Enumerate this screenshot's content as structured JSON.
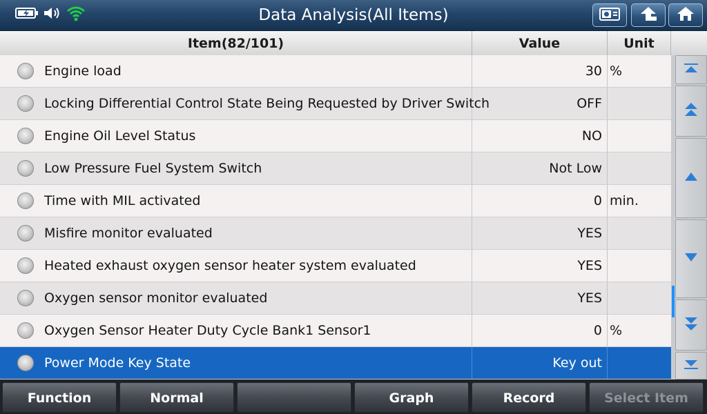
{
  "titlebar": {
    "title": "Data Analysis(All Items)",
    "status_icons": [
      "battery-icon",
      "speaker-icon",
      "wifi-icon"
    ],
    "buttons": [
      {
        "name": "screenshot-button",
        "icon": "camera-icon"
      },
      {
        "name": "back-button",
        "icon": "arrow-up-icon"
      },
      {
        "name": "home-button",
        "icon": "home-icon"
      }
    ]
  },
  "table": {
    "headers": {
      "item": "Item(82/101)",
      "value": "Value",
      "unit": "Unit"
    },
    "rows": [
      {
        "label": "Engine load",
        "value": "30",
        "unit": "%"
      },
      {
        "label": "Locking Differential Control State Being Requested by Driver Switch",
        "value": "OFF",
        "unit": ""
      },
      {
        "label": "Engine Oil Level Status",
        "value": "NO",
        "unit": ""
      },
      {
        "label": "Low Pressure Fuel System Switch",
        "value": "Not Low",
        "unit": ""
      },
      {
        "label": "Time with MIL activated",
        "value": "0",
        "unit": "min."
      },
      {
        "label": "Misfire monitor evaluated",
        "value": "YES",
        "unit": ""
      },
      {
        "label": "Heated exhaust oxygen sensor heater system evaluated",
        "value": "YES",
        "unit": ""
      },
      {
        "label": "Oxygen sensor monitor evaluated",
        "value": "YES",
        "unit": ""
      },
      {
        "label": "Oxygen Sensor Heater Duty Cycle Bank1 Sensor1",
        "value": "0",
        "unit": "%"
      },
      {
        "label": "Power Mode Key State",
        "value": "Key out",
        "unit": "",
        "selected": true
      }
    ]
  },
  "scrollbar": {
    "buttons": [
      "scroll-top-button",
      "page-up-button",
      "line-up-button",
      "line-down-button",
      "page-down-button",
      "scroll-bottom-button"
    ]
  },
  "bottombar": {
    "buttons": [
      {
        "label": "Function",
        "enabled": true
      },
      {
        "label": "Normal",
        "enabled": true
      },
      {
        "label": "",
        "enabled": true
      },
      {
        "label": "Graph",
        "enabled": true
      },
      {
        "label": "Record",
        "enabled": true
      },
      {
        "label": "Select Item",
        "enabled": false
      }
    ]
  },
  "colors": {
    "selected_row": "#1767c2",
    "title_bar": "#24456a",
    "wifi": "#22cc44"
  }
}
